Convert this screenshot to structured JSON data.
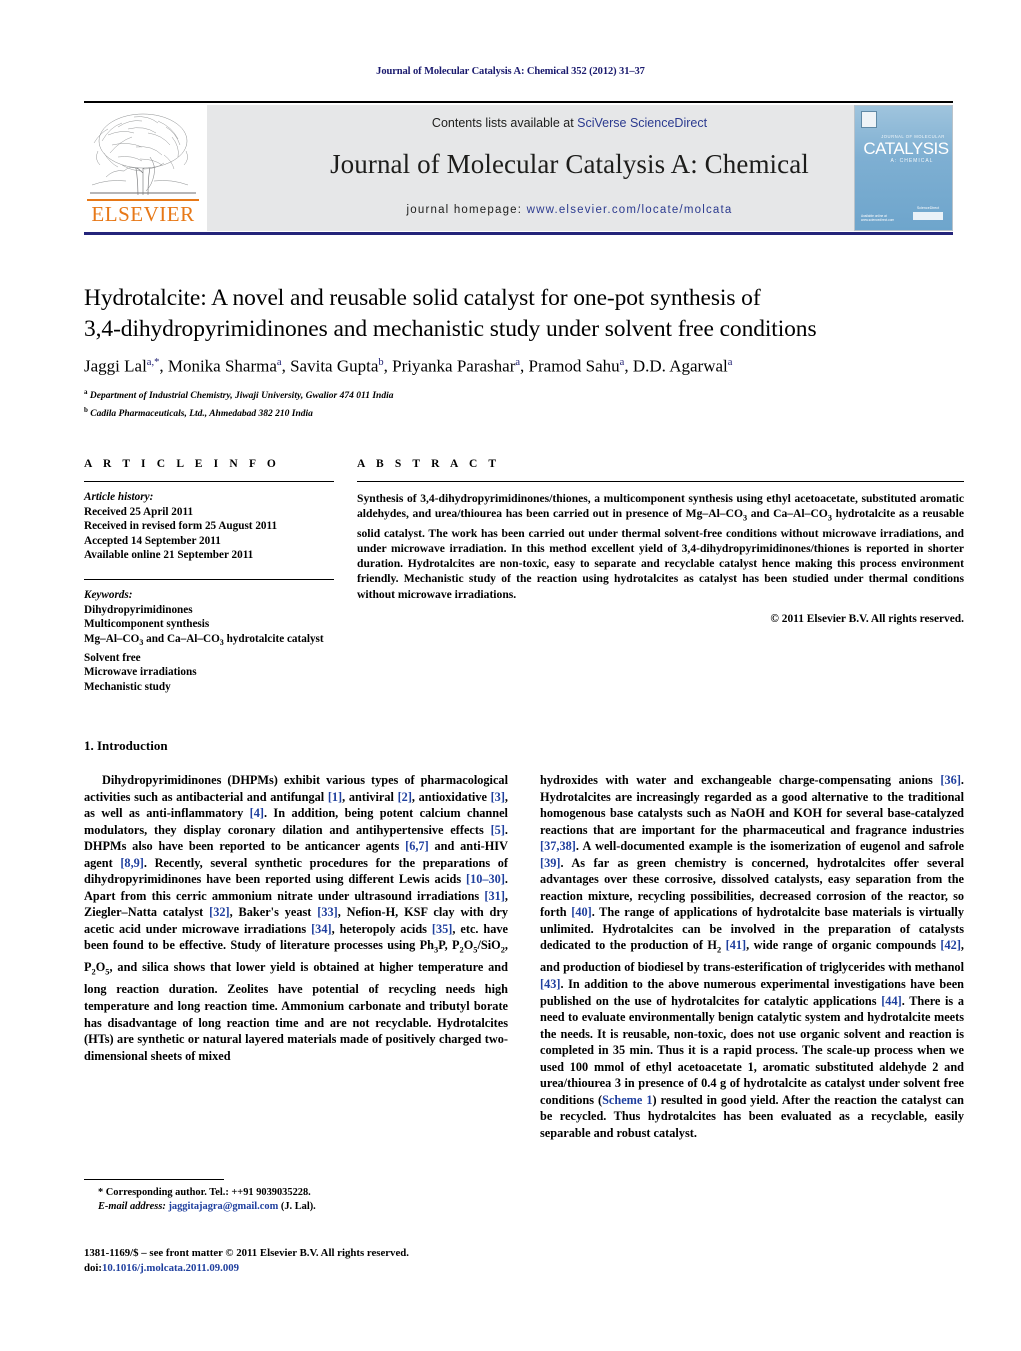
{
  "running_head": "Journal of Molecular Catalysis A: Chemical 352 (2012) 31–37",
  "masthead": {
    "contents_prefix": "Contents lists available at ",
    "contents_link": "SciVerse ScienceDirect",
    "journal_title": "Journal of Molecular Catalysis A: Chemical",
    "homepage_prefix": "journal homepage: ",
    "homepage_url": "www.elsevier.com/locate/molcata",
    "publisher_wordmark": "ELSEVIER",
    "cover": {
      "supertitle": "JOURNAL OF MOLECULAR",
      "main": "CATALYSIS",
      "subtitle": "A: CHEMICAL",
      "footmark": "ScienceDirect",
      "footleft": "Available online at www.sciencedirect.com"
    },
    "link_color": "#2b3a8f",
    "band_color": "#e6e7e8",
    "cover_color": "#7fb0d3",
    "elsevier_orange": "#E77817"
  },
  "article": {
    "title_line1": "Hydrotalcite: A novel and reusable solid catalyst for one-pot synthesis of",
    "title_line2": "3,4-dihydropyrimidinones and mechanistic study under solvent free conditions",
    "authors_html": "Jaggi Lal<sup>a,*</sup>, Monika Sharma<sup>a</sup>, Savita Gupta<sup>b</sup>, Priyanka Parashar<sup>a</sup>, Pramod Sahu<sup>a</sup>, D.D. Agarwal<sup>a</sup>",
    "affiliation_a": "Department of Industrial Chemistry, Jiwaji University, Gwalior 474 011 India",
    "affiliation_b": "Cadila Pharmaceuticals, Ltd., Ahmedabad 382 210 India"
  },
  "article_info": {
    "label": "A R T I C L E    I N F O",
    "history_label": "Article history:",
    "history": [
      "Received 25 April 2011",
      "Received in revised form 25 August 2011",
      "Accepted 14 September 2011",
      "Available online 21 September 2011"
    ],
    "keywords_label": "Keywords:",
    "keywords_html": [
      "Dihydropyrimidinones",
      "Multicomponent synthesis",
      "Mg–Al–CO<sub>3</sub> and Ca–Al–CO<sub>3</sub> hydrotalcite catalyst",
      "Solvent free",
      "Microwave irradiations",
      "Mechanistic study"
    ]
  },
  "abstract": {
    "label": "A B S T R A C T",
    "body_html": "Synthesis of 3,4-dihydropyrimidinones/thiones, a multicomponent synthesis using ethyl acetoacetate, substituted aromatic aldehydes, and urea/thiourea has been carried out in presence of Mg–Al–CO<sub>3</sub> and Ca–Al–CO<sub>3</sub> hydrotalcite as a reusable solid catalyst. The work has been carried out under thermal solvent-free conditions without microwave irradiations, and under microwave irradiation. In this method excellent yield of 3,4-dihydropyrimidinones/thiones is reported in shorter duration. Hydrotalcites are non-toxic, easy to separate and recyclable catalyst hence making this process environment friendly. Mechanistic study of the reaction using hydrotalcites as catalyst has been studied under thermal conditions without microwave irradiations.",
    "copyright": "© 2011 Elsevier B.V. All rights reserved."
  },
  "body": {
    "section_heading": "1.  Introduction",
    "left_column_html": "Dihydropyrimidinones (DHPMs) exhibit various types of pharmacological activities such as antibacterial and antifungal <span class=\"ref\">[1]</span>, antiviral <span class=\"ref\">[2]</span>, antioxidative <span class=\"ref\">[3]</span>, as well as anti-inflammatory <span class=\"ref\">[4]</span>. In addition, being potent calcium channel modulators, they display coronary dilation and antihypertensive effects <span class=\"ref\">[5]</span>. DHPMs also have been reported to be anticancer agents <span class=\"ref\">[6,7]</span> and anti-HIV agent <span class=\"ref\">[8,9]</span>. Recently, several synthetic procedures for the preparations of dihydropyrimidinones have been reported using different Lewis acids <span class=\"ref\">[10–30]</span>. Apart from this cerric ammonium nitrate under ultrasound irradiations <span class=\"ref\">[31]</span>, Ziegler–Natta catalyst <span class=\"ref\">[32]</span>, Baker's yeast <span class=\"ref\">[33]</span>, Nefion-H, KSF clay with dry acetic acid under microwave irradiations <span class=\"ref\">[34]</span>, heteropoly acids <span class=\"ref\">[35]</span>, etc. have been found to be effective. Study of literature processes using Ph<sub class=\"chem\">3</sub>P, P<sub class=\"chem\">2</sub>O<sub class=\"chem\">5</sub>/SiO<sub class=\"chem\">2</sub>, P<sub class=\"chem\">2</sub>O<sub class=\"chem\">5</sub>, and silica shows that lower yield is obtained at higher temperature and long reaction duration. Zeolites have potential of recycling needs high temperature and long reaction time. Ammonium carbonate and tributyl borate has disadvantage of long reaction time and are not recyclable. Hydrotalcites (HTs) are synthetic or natural layered materials made of positively charged two-dimensional sheets of mixed",
    "right_column_html": "hydroxides with water and exchangeable charge-compensating anions <span class=\"ref\">[36]</span>. Hydrotalcites are increasingly regarded as a good alternative to the traditional homogenous base catalysts such as NaOH and KOH for several base-catalyzed reactions that are important for the pharmaceutical and fragrance industries <span class=\"ref\">[37,38]</span>. A well-documented example is the isomerization of eugenol and safrole <span class=\"ref\">[39]</span>. As far as green chemistry is concerned, hydrotalcites offer several advantages over these corrosive, dissolved catalysts, easy separation from the reaction mixture, recycling possibilities, decreased corrosion of the reactor, so forth <span class=\"ref\">[40]</span>. The range of applications of hydrotalcite base materials is virtually unlimited. Hydrotalcites can be involved in the preparation of catalysts dedicated to the production of H<sub class=\"chem\">2</sub> <span class=\"ref\">[41]</span>, wide range of organic compounds <span class=\"ref\">[42]</span>, and production of biodiesel by trans-esterification of triglycerides with methanol <span class=\"ref\">[43]</span>. In addition to the above numerous experimental investigations have been published on the use of hydrotalcites for catalytic applications <span class=\"ref\">[44]</span>. There is a need to evaluate environmentally benign catalytic system and hydrotalcite meets the needs. It is reusable, non-toxic, does not use organic solvent and reaction is completed in 35 min. Thus it is a rapid process. The scale-up process when we used 100 mmol of ethyl acetoacetate <b>1</b>, aromatic substituted aldehyde <b>2</b> and urea/thiourea <b>3</b> in presence of 0.4 g of hydrotalcite as catalyst under solvent free conditions (<span class=\"ref\">Scheme 1</span>) resulted in good yield. After the reaction the catalyst can be recycled. Thus hydrotalcites has been evaluated as a recyclable, easily separable and robust catalyst."
  },
  "footnote": {
    "corresponding_line": "* Corresponding author. Tel.: ++91 9039035228.",
    "email_label": "E-mail address:",
    "email": "jaggitajagra@gmail.com",
    "email_suffix": "(J. Lal)."
  },
  "footer": {
    "issn_line": "1381-1169/$ – see front matter © 2011 Elsevier B.V. All rights reserved.",
    "doi_prefix": "doi:",
    "doi": "10.1016/j.molcata.2011.09.009"
  }
}
